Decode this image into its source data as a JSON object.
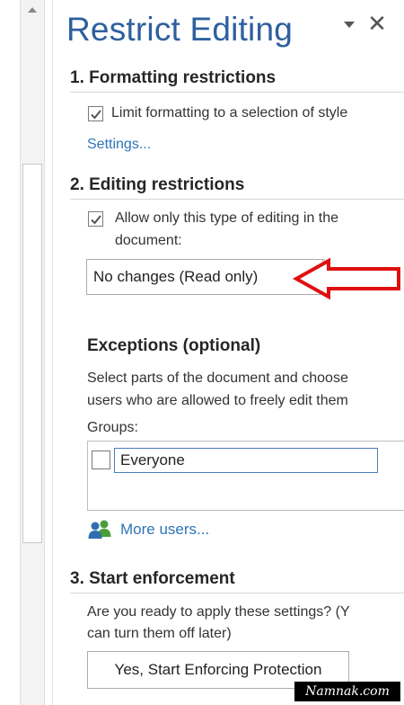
{
  "pane": {
    "title": "Restrict Editing",
    "options_icon": "chevron-down-icon",
    "close_glyph": "✕"
  },
  "formatting": {
    "heading": "1. Formatting restrictions",
    "checkbox_label": "Limit formatting to a selection of style",
    "checked": true,
    "settings_link": "Settings..."
  },
  "editing": {
    "heading": "2. Editing restrictions",
    "checkbox_label_line1": "Allow only this type of editing in the",
    "checkbox_label_line2": "document:",
    "checked": true,
    "selected_mode": "No changes (Read only)"
  },
  "exceptions": {
    "heading": "Exceptions (optional)",
    "description_line1": "Select parts of the document and choose",
    "description_line2": "users who are allowed to freely edit them",
    "groups_label": "Groups:",
    "groups": [
      {
        "name": "Everyone",
        "checked": false
      }
    ],
    "more_users_link": "More users..."
  },
  "enforcement": {
    "heading": "3. Start enforcement",
    "question_line1": "Are you ready to apply these settings? (Y",
    "question_line2": "can turn them off later)",
    "button_label": "Yes, Start Enforcing Protection"
  },
  "watermark": "Namnak.com",
  "colors": {
    "title_blue": "#2e5f9e",
    "link_blue": "#2e75b6",
    "annotation_red": "#e01010",
    "users_icon_blue": "#2f6fb0",
    "users_icon_green": "#4a9e3a"
  }
}
